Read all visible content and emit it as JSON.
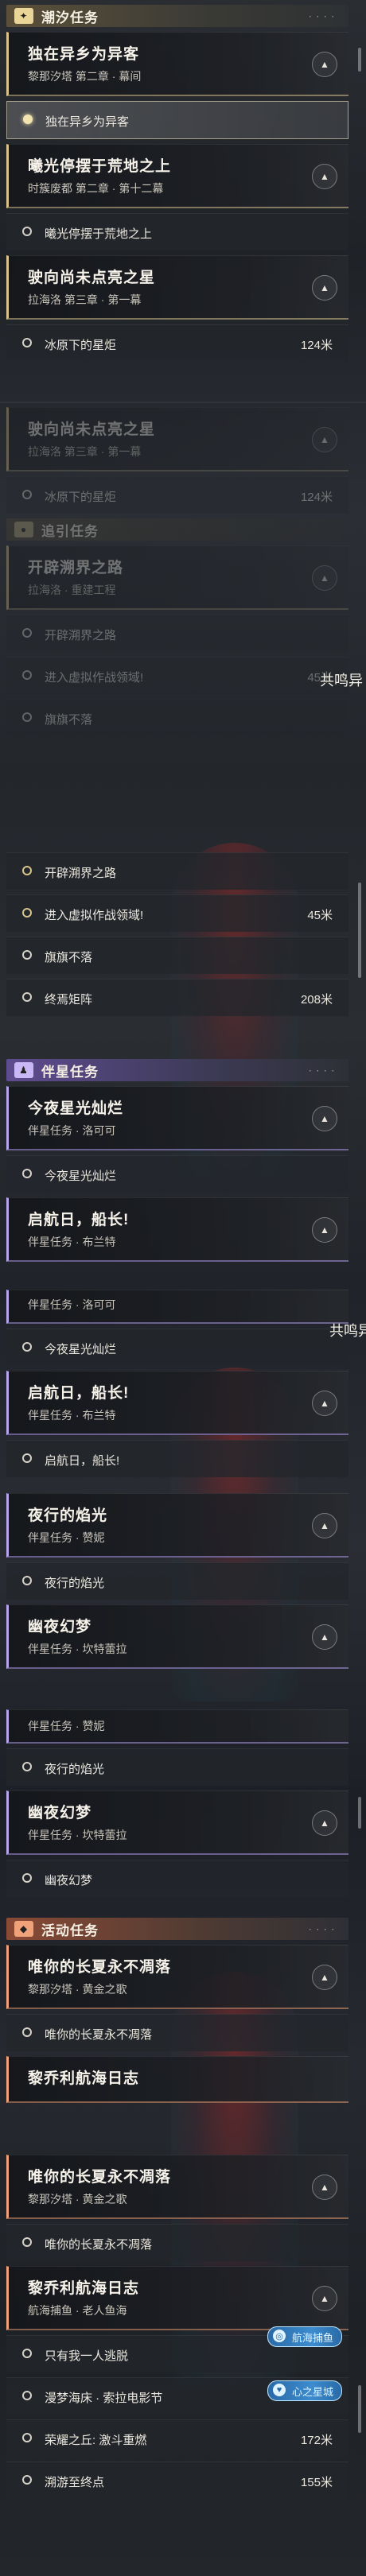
{
  "categories": {
    "tide": "潮汐任务",
    "guide": "追引任务",
    "companion": "伴星任务",
    "event": "活动任务"
  },
  "category_icons": {
    "tide": "sparkle-icon",
    "guide": "location-pin-icon",
    "companion": "person-icon",
    "event": "event-icon"
  },
  "colors": {
    "gold_accent": "#d9c48c",
    "purple_accent": "#b7a6ee",
    "orange_accent": "#f0a27a"
  },
  "tasks": {
    "t1": {
      "title": "独在异乡为异客",
      "subtitle": "黎那汐塔 第二章 · 幕间"
    },
    "t2": {
      "title": "曦光停摆于荒地之上",
      "subtitle": "时簇废都 第二章 · 第十二幕"
    },
    "t3": {
      "title": "驶向尚未点亮之星",
      "subtitle": "拉海洛 第三章 · 第一幕"
    },
    "t4": {
      "title": "开辟溯界之路",
      "subtitle": "拉海洛 · 重建工程"
    },
    "c1": {
      "title": "今夜星光灿烂",
      "subtitle": "伴星任务 · 洛可可"
    },
    "c2": {
      "title": "启航日，船长!",
      "subtitle": "伴星任务 · 布兰特"
    },
    "c3": {
      "title": "夜行的焰光",
      "subtitle": "伴星任务 · 赞妮"
    },
    "c4": {
      "title": "幽夜幻梦",
      "subtitle": "伴星任务 · 坎特蕾拉"
    },
    "e1": {
      "title": "唯你的长夏永不凋落",
      "subtitle": "黎那汐塔 · 黄金之歌"
    },
    "e2": {
      "title": "黎乔利航海日志",
      "subtitle": "航海捕鱼 · 老人鱼海"
    }
  },
  "subs": {
    "s1": "独在异乡为异客",
    "s2": "曦光停摆于荒地之上",
    "s3": "冰原下的星炬",
    "s4": "开辟溯界之路",
    "s5": "进入虚拟作战领域!",
    "s6": "旗旗不落",
    "s7": "终焉矩阵",
    "s8": "今夜星光灿烂",
    "s9": "启航日，船长!",
    "s10": "夜行的焰光",
    "s11": "幽夜幻梦",
    "s12": "唯你的长夏永不凋落",
    "s13": "只有我一人逃脱",
    "s14": "漫梦海床 · 索拉电影节",
    "s15": "荣耀之丘: 激斗重燃",
    "s16": "溯游至终点"
  },
  "distances": {
    "d3": "124米",
    "d5": "45米",
    "d7": "208米",
    "d15": "172米",
    "d16": "155米"
  },
  "side": {
    "overflow_text": "共鸣异",
    "badge_fishing": "航海捕鱼",
    "badge_heart": "心之星城"
  }
}
